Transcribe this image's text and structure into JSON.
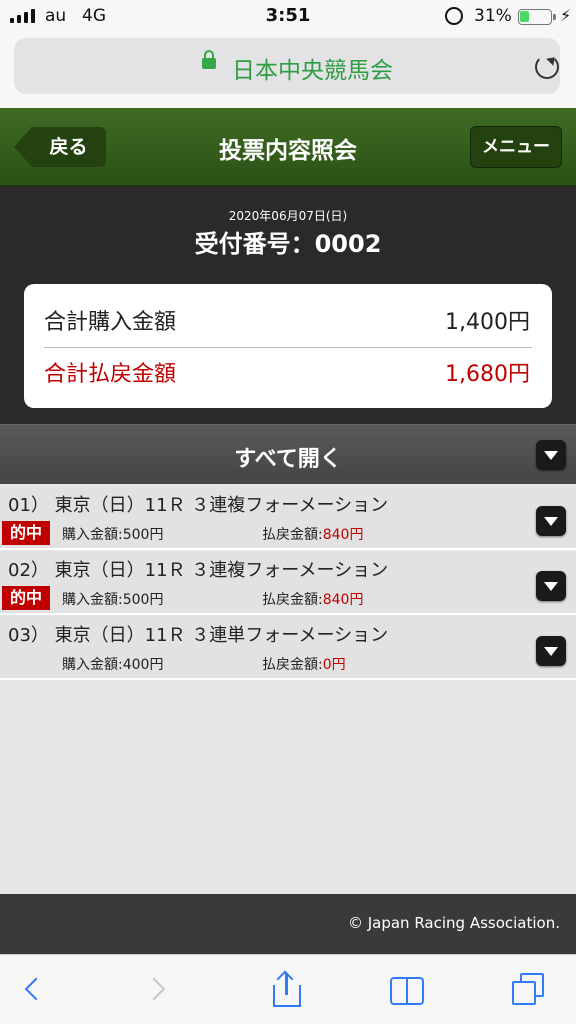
{
  "status_bar": {
    "carrier": "au",
    "network": "4G",
    "time": "3:51",
    "battery_percent": "31%",
    "battery_level": 0.31,
    "colors": {
      "battery_fill": "#4cd964"
    }
  },
  "browser": {
    "site_name": "日本中央競馬会",
    "colors": {
      "site_name": "#2e9d44",
      "toolbar_icons": "#2f7cf6"
    }
  },
  "header": {
    "back_label": "戻る",
    "title": "投票内容照会",
    "menu_label": "メニュー",
    "colors": {
      "background": "#3f6b24"
    }
  },
  "receipt": {
    "date": "2020年06月07日(日)",
    "number_line": "受付番号：0002"
  },
  "summary": {
    "purchase_label": "合計購入金額",
    "purchase_value": "1,400円",
    "payout_label": "合計払戻金額",
    "payout_value": "1,680円",
    "colors": {
      "payout": "#c00000"
    }
  },
  "open_all_label": "すべて開く",
  "bets": [
    {
      "title": "01） 東京（日）11Ｒ ３連複フォーメーション",
      "hit_badge": "的中",
      "buy_label": "購入金額:500円",
      "pay_label": "払戻金額:",
      "pay_value": "840円"
    },
    {
      "title": "02） 東京（日）11Ｒ ３連複フォーメーション",
      "hit_badge": "的中",
      "buy_label": "購入金額:500円",
      "pay_label": "払戻金額:",
      "pay_value": "840円"
    },
    {
      "title": "03） 東京（日）11Ｒ ３連単フォーメーション",
      "hit_badge": "",
      "buy_label": "購入金額:400円",
      "pay_label": "払戻金額:",
      "pay_value": "0円"
    }
  ],
  "footer": {
    "copyright": "© Japan Racing Association."
  },
  "toolbar_icons": [
    "back-arrow-icon",
    "forward-arrow-icon",
    "share-icon",
    "bookmarks-icon",
    "tabs-icon"
  ]
}
